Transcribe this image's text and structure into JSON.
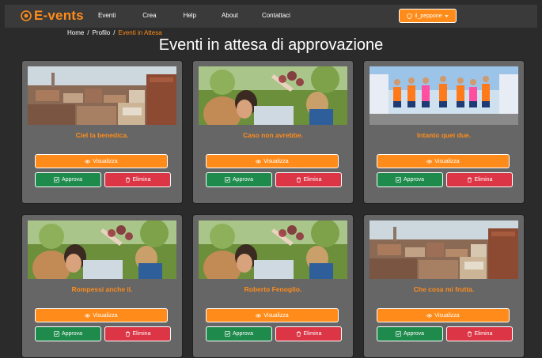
{
  "brand": "E-vents",
  "nav": {
    "items": [
      "Eventi",
      "Crea",
      "Help",
      "About",
      "Contattaci"
    ],
    "user": "il_peppone"
  },
  "breadcrumb": [
    "Home",
    "Profilo",
    "Eventi in Attesa"
  ],
  "page_title": "Eventi in attesa di approvazione",
  "labels": {
    "view": "Visualizza",
    "approve": "Approva",
    "delete": "Elimina"
  },
  "cards": [
    {
      "title": "Ciel la benedica.",
      "image": "city"
    },
    {
      "title": "Caso non avrebbe.",
      "image": "toast"
    },
    {
      "title": "Intanto quei due.",
      "image": "runners"
    },
    {
      "title": "Rompessi anche il.",
      "image": "toast"
    },
    {
      "title": "Roberto Fenoglio.",
      "image": "toast"
    },
    {
      "title": "Che cosa mi frutta.",
      "image": "city"
    }
  ],
  "colors": {
    "accent": "#ff8c1a",
    "approve": "#1e8a4c",
    "delete": "#dc3545",
    "card": "#666666",
    "bg": "#2b2b2b"
  }
}
